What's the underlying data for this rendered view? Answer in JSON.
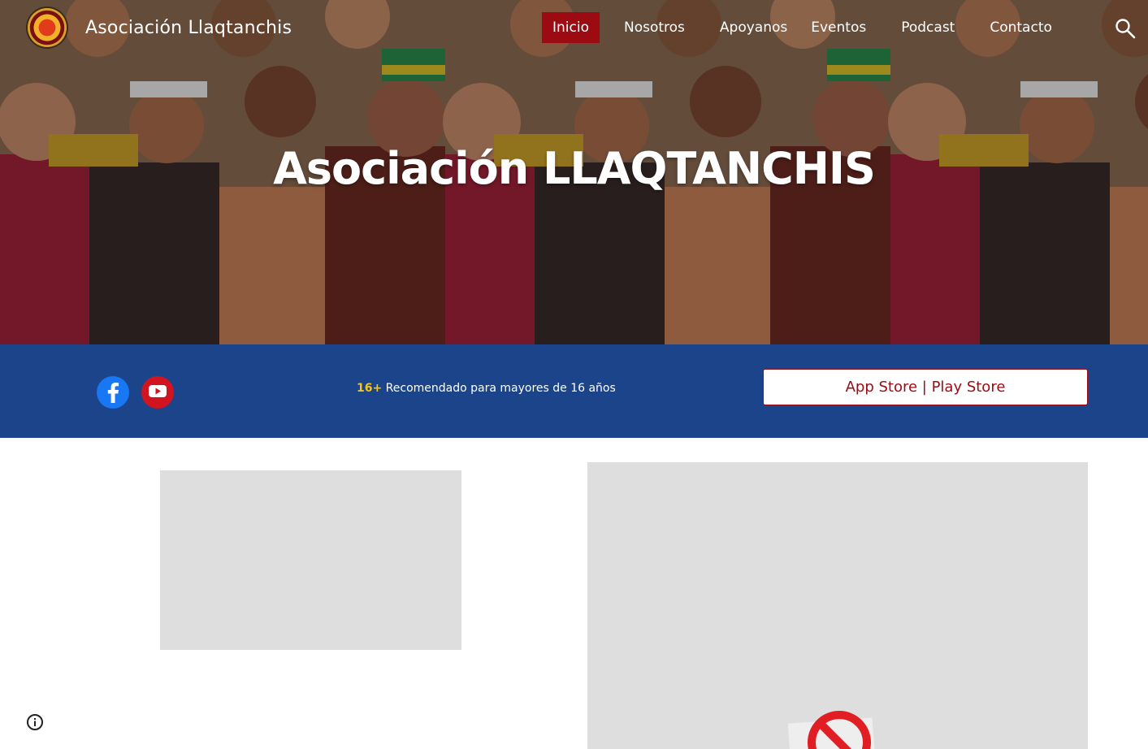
{
  "site": {
    "title": "Asociación Llaqtanchis"
  },
  "nav": {
    "items": [
      {
        "label": "Inicio",
        "active": true
      },
      {
        "label": "Nosotros"
      },
      {
        "label": "Apoyanos"
      },
      {
        "label": "Eventos"
      },
      {
        "label": "Podcast"
      },
      {
        "label": "Contacto"
      }
    ],
    "search_icon": "search-icon"
  },
  "hero": {
    "title": "Asociación LLAQTANCHIS"
  },
  "band": {
    "social": [
      {
        "name": "facebook-icon",
        "color": "#1877f2"
      },
      {
        "name": "youtube-icon",
        "color": "#d1141f"
      }
    ],
    "age_badge": "16+",
    "age_text": "Recomendado para mayores de 16 años",
    "store_button": "App Store | Play Store"
  },
  "colors": {
    "accent_red": "#9c0b12",
    "band_blue": "#1c448a",
    "placeholder_gray": "#dedede"
  }
}
